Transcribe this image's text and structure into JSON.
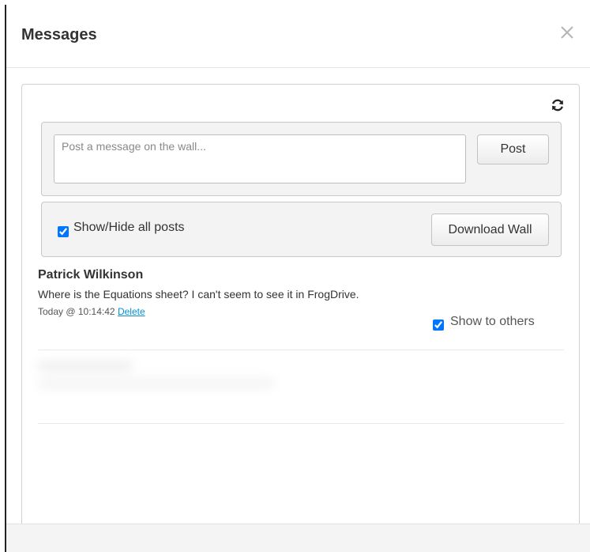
{
  "modal": {
    "title": "Messages",
    "close_icon": "close-icon"
  },
  "wall": {
    "refresh_icon": "refresh-icon",
    "post_placeholder": "Post a message on the wall...",
    "post_value": "",
    "post_button": "Post",
    "show_hide_label": "Show/Hide all posts",
    "show_hide_checked": true,
    "download_button": "Download Wall"
  },
  "posts": [
    {
      "author": "Patrick Wilkinson",
      "text": "Where is the Equations sheet? I can't seem to see it in FrogDrive.",
      "timestamp": "Today @ 10:14:42",
      "delete_label": "Delete",
      "show_to_others_label": "Show to others",
      "show_to_others_checked": true
    }
  ]
}
